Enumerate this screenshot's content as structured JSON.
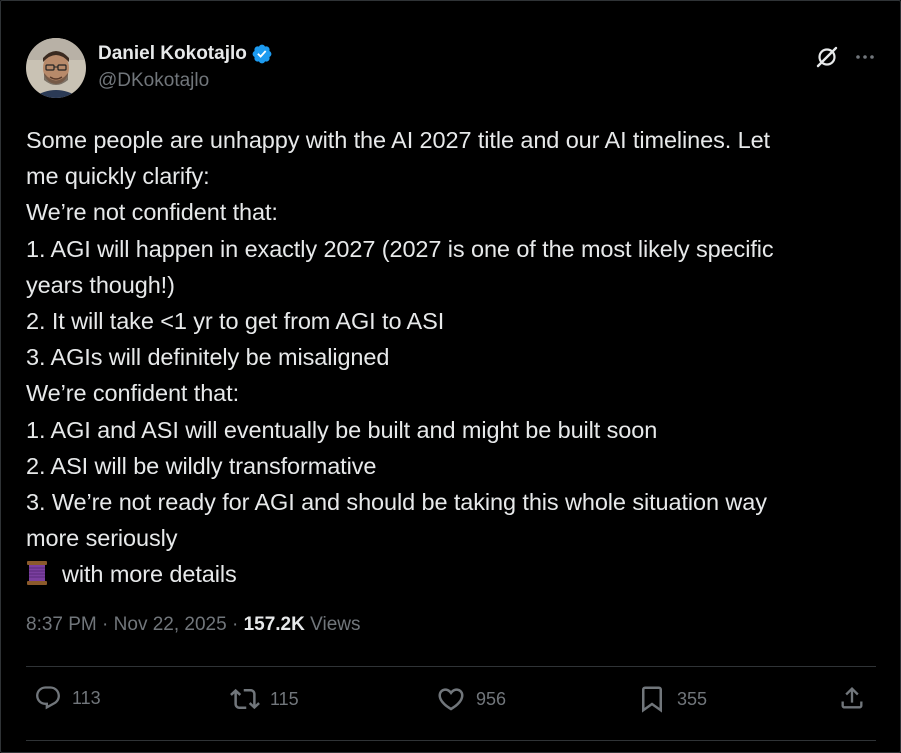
{
  "author": {
    "display_name": "Daniel Kokotajlo",
    "handle": "@DKokotajlo",
    "verified_color": "#1d9bf0"
  },
  "tweet": {
    "lines": [
      "Some people are unhappy with the AI 2027 title and our AI timelines. Let",
      "me quickly clarify:",
      "We’re not confident that:",
      "1. AGI will happen in exactly 2027 (2027 is one of the most likely specific",
      "years though!)",
      "2. It will take <1 yr to get from AGI to ASI",
      "3. AGIs will definitely be misaligned",
      "We’re confident that:",
      "1. AGI and ASI will eventually be built and might be built soon",
      "2. ASI will be wildly transformative",
      "3. We’re not ready for AGI and should be taking this whole situation way",
      "more seriously"
    ],
    "last_line_emoji": "thread-spool-emoji",
    "last_line_text": "with more details"
  },
  "meta": {
    "time": "8:37 PM",
    "separator": " · ",
    "date": "Nov 22, 2025",
    "views_count": "157.2K",
    "views_label": " Views"
  },
  "actions": {
    "replies": "113",
    "reposts": "115",
    "likes": "956",
    "bookmarks": "355"
  },
  "icons": [
    "verified-badge-icon",
    "grok-icon",
    "more-icon",
    "reply-icon",
    "repost-icon",
    "like-icon",
    "bookmark-icon",
    "share-icon"
  ],
  "colors": {
    "background": "#000000",
    "primary_text": "#e7e9ea",
    "secondary_text": "#71767b",
    "divider": "#2f3336",
    "verified": "#1d9bf0"
  }
}
